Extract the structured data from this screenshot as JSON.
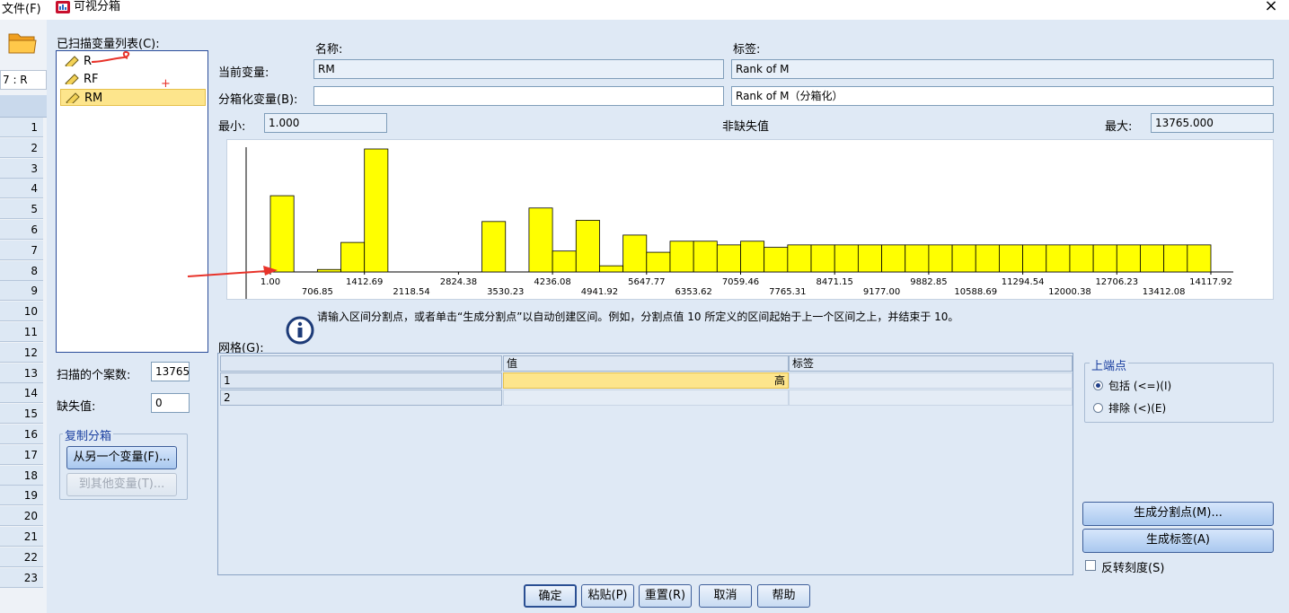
{
  "background_app": {
    "menu_file": "文件(F)",
    "cell_ref": "7 : R",
    "row_numbers": [
      "1",
      "2",
      "3",
      "4",
      "5",
      "6",
      "7",
      "8",
      "9",
      "10",
      "11",
      "12",
      "13",
      "14",
      "15",
      "16",
      "17",
      "18",
      "19",
      "20",
      "21",
      "22",
      "23"
    ]
  },
  "dialog": {
    "title": "可视分箱",
    "close": "×"
  },
  "scanned_list": {
    "label": "已扫描变量列表(C):",
    "items": [
      {
        "name": "R",
        "selected": false
      },
      {
        "name": "RF",
        "selected": false
      },
      {
        "name": "RM",
        "selected": true
      }
    ]
  },
  "variable_info": {
    "name_header": "名称:",
    "label_header": "标签:",
    "current_label": "当前变量:",
    "current_name": "RM",
    "current_varlabel": "Rank of M",
    "binned_label": "分箱化变量(B):",
    "binned_name": "",
    "binned_varlabel": "Rank of M（分箱化）",
    "min_label": "最小:",
    "min_value": "1.000",
    "nonmissing_label": "非缺失值",
    "max_label": "最大:",
    "max_value": "13765.000"
  },
  "scan_stats": {
    "cases_label": "扫描的个案数:",
    "cases_value": "13765",
    "missing_label": "缺失值:",
    "missing_value": "0"
  },
  "copy_bins": {
    "title": "复制分箱",
    "from_button": "从另一个变量(F)...",
    "to_button": "到其他变量(T)..."
  },
  "info_text": "请输入区间分割点，或者单击“生成分割点”以自动创建区间。例如，分割点值 10 所定义的区间起始于上一个区间之上，并结束于 10。",
  "grid": {
    "label": "网格(G):",
    "headers": [
      "值",
      "标签"
    ],
    "rows": [
      {
        "num": "1",
        "value": "高",
        "label": ""
      },
      {
        "num": "2",
        "value": "",
        "label": ""
      }
    ]
  },
  "upper_endpoint": {
    "title": "上端点",
    "include": "包括 (<=)(I)",
    "exclude": "排除 (<)(E)",
    "selected": "include"
  },
  "actions": {
    "make_cutpoints": "生成分割点(M)...",
    "make_labels": "生成标签(A)",
    "reverse_scale": "反转刻度(S)",
    "reverse_checked": false
  },
  "footer": {
    "ok": "确定",
    "paste": "粘贴(P)",
    "reset": "重置(R)",
    "cancel": "取消",
    "help": "帮助"
  },
  "colors": {
    "bar_fill": "#ffff00",
    "dialog_bg": "#dfe9f5",
    "selection": "#fde58c",
    "annotation_red": "#e8332a"
  },
  "chart_data": {
    "type": "bar",
    "x_tick_labels_upper": [
      "1.00",
      "1412.69",
      "2824.38",
      "4236.08",
      "5647.77",
      "7059.46",
      "8471.15",
      "9882.85",
      "11294.54",
      "12706.23",
      "14117.92"
    ],
    "x_tick_labels_lower": [
      "706.85",
      "2118.54",
      "3530.23",
      "4941.92",
      "6353.62",
      "7765.31",
      "9177.00",
      "10588.69",
      "12000.38",
      "13412.08"
    ],
    "xlim": [
      1.0,
      14117.92
    ],
    "bin_values": [
      0.62,
      0,
      0.02,
      0.24,
      1.0,
      0,
      0,
      0,
      0,
      0.41,
      0,
      0.52,
      0.17,
      0.42,
      0.05,
      0.3,
      0.16,
      0.25,
      0.25,
      0.22,
      0.25,
      0.2,
      0.22,
      0.22,
      0.22,
      0.22,
      0.22,
      0.22,
      0.22,
      0.22,
      0.22,
      0.22,
      0.22,
      0.22,
      0.22,
      0.22,
      0.22,
      0.22,
      0.22,
      0.22
    ]
  }
}
